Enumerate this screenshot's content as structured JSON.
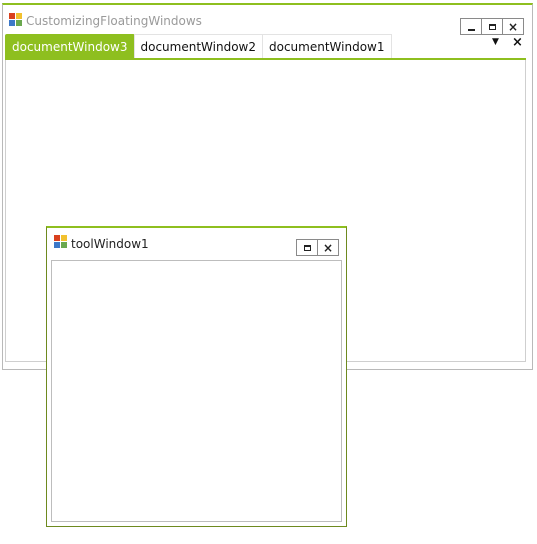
{
  "main_window": {
    "title": "CustomizingFloatingWindows",
    "icon": "app-window-icon",
    "buttons": {
      "minimize": "minimize-icon",
      "maximize": "maximize-icon",
      "close": "close-icon"
    }
  },
  "tabs": [
    {
      "label": "documentWindow3",
      "active": true
    },
    {
      "label": "documentWindow2",
      "active": false
    },
    {
      "label": "documentWindow1",
      "active": false
    }
  ],
  "tab_strip": {
    "menu_icon": "dropdown-arrow-icon",
    "close_icon": "close-icon"
  },
  "tool_window": {
    "title": "toolWindow1",
    "icon": "app-window-icon",
    "buttons": {
      "maximize": "maximize-icon",
      "close": "close-icon"
    }
  },
  "colors": {
    "accent": "#8ebf1f",
    "border": "#b9b9b9"
  }
}
